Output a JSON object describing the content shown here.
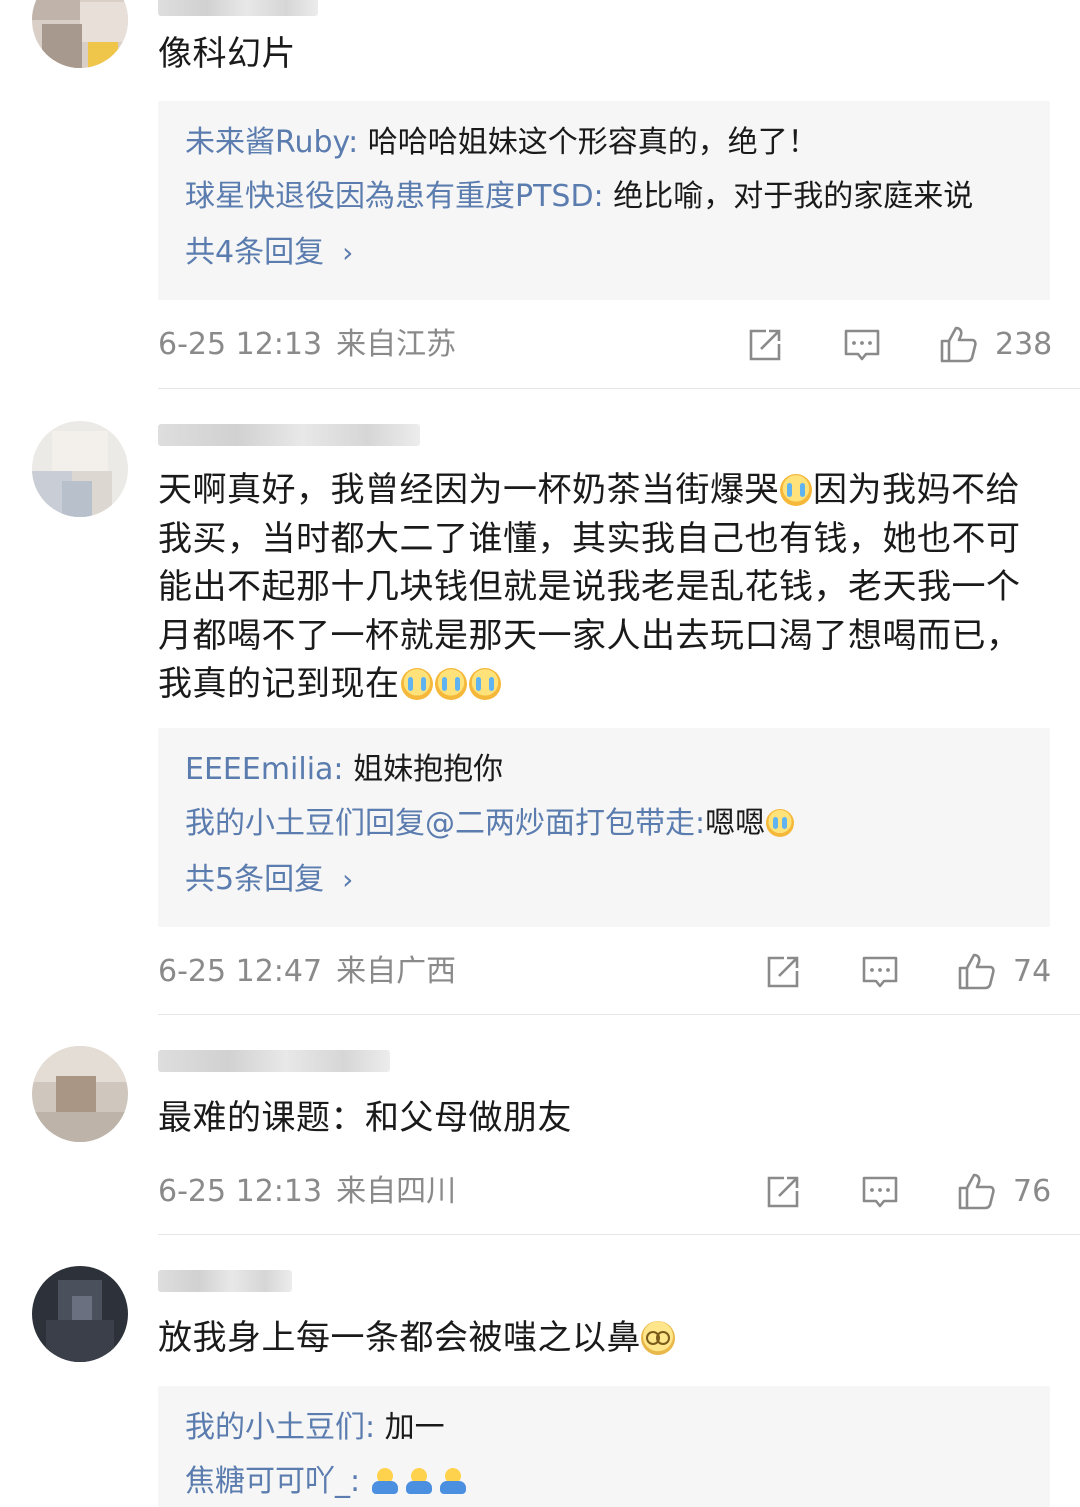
{
  "colors": {
    "reply_name": "#5b7cae",
    "body_text": "#1a1a1a",
    "meta_text": "#8a8a8a",
    "reply_bg": "#f6f6f6"
  },
  "comments": [
    {
      "body": "像科幻片",
      "replies": [
        {
          "name": "未来酱Ruby:",
          "text": " 哈哈哈姐妹这个形容真的，绝了！"
        },
        {
          "name": "球星快退役因為患有重度PTSD:",
          "text": " 绝比喻，对于我的家庭来说"
        }
      ],
      "more": "共4条回复",
      "time": "6-25 12:13",
      "location": "来自江苏",
      "likes": "238",
      "icons": [
        "share-icon",
        "comment-icon",
        "like-icon"
      ]
    },
    {
      "body_parts": [
        "天啊真好，我曾经因为一杯奶茶当街爆哭",
        "因为我妈不给我买，当时都大二了谁懂，其实我自己也有钱，她也不可能出不起那十几块钱但就是说我老是乱花钱，老天我一个月都喝不了一杯就是那天一家人出去玩口渴了想喝而已，我真的记到现在"
      ],
      "emoji": "crying-emoji",
      "replies": [
        {
          "name": "EEEEmilia:",
          "text": " 姐妹抱抱你"
        },
        {
          "name": "我的小土豆们回复@二两炒面打包带走:",
          "text": "嗯嗯"
        }
      ],
      "more": "共5条回复",
      "time": "6-25 12:47",
      "location": "来自广西",
      "likes": "74",
      "icons": [
        "share-icon",
        "comment-icon",
        "like-icon"
      ]
    },
    {
      "body": "最难的课题：和父母做朋友",
      "time": "6-25 12:13",
      "location": "来自四川",
      "likes": "76",
      "icons": [
        "share-icon",
        "comment-icon",
        "like-icon"
      ]
    },
    {
      "body": "放我身上每一条都会被嗤之以鼻",
      "emoji": "shy-emoji",
      "replies": [
        {
          "name": "我的小土豆们:",
          "text": " 加一"
        },
        {
          "name": "焦糖可可吖_:",
          "text": " "
        }
      ],
      "reply_emoji": "hug-emoji"
    }
  ]
}
